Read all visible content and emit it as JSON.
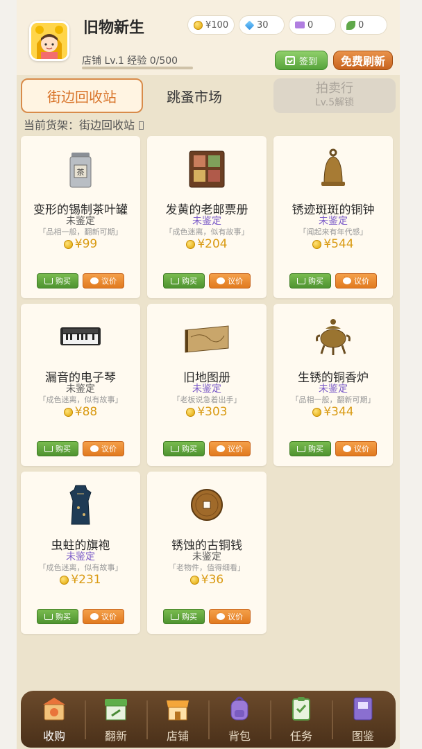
{
  "header": {
    "shop_name": "旧物新生",
    "level_text": "店铺 Lv.1  经验 0/500",
    "exp_fraction": 0.0,
    "currencies": [
      {
        "icon": "coin-icon",
        "value": "¥100"
      },
      {
        "icon": "diamond-icon",
        "value": "30"
      },
      {
        "icon": "ticket-icon",
        "value": "0"
      },
      {
        "icon": "leaf-icon",
        "value": "0"
      }
    ],
    "signin_label": "签到",
    "refresh_label": "免费刷新"
  },
  "tabs": {
    "street": "街边回收站",
    "market": "跳蚤市场",
    "auction": "拍卖行",
    "auction_unlock": "Lv.5解锁"
  },
  "shelf_label": "当前货架：街边回收站",
  "buttons": {
    "buy": "购买",
    "haggle": "议价"
  },
  "items": [
    {
      "name": "变形的锡制茶叶罐",
      "status": "未鉴定",
      "quote": "「品相一般，翻新可期」",
      "price": "¥99",
      "icon": "tea-tin-icon"
    },
    {
      "name": "发黄的老邮票册",
      "status": "未鉴定",
      "quote": "「成色迷离，似有故事」",
      "price": "¥204",
      "icon": "stamp-album-icon"
    },
    {
      "name": "锈迹斑斑的铜钟",
      "status": "未鉴定",
      "quote": "「闻起来有年代感」",
      "price": "¥544",
      "icon": "bronze-bell-icon"
    },
    {
      "name": "漏音的电子琴",
      "status": "未鉴定",
      "quote": "「成色迷离，似有故事」",
      "price": "¥88",
      "icon": "keyboard-icon"
    },
    {
      "name": "旧地图册",
      "status": "未鉴定",
      "quote": "「老板说急着出手」",
      "price": "¥303",
      "icon": "map-book-icon"
    },
    {
      "name": "生锈的铜香炉",
      "status": "未鉴定",
      "quote": "「品相一般，翻新可期」",
      "price": "¥344",
      "icon": "incense-burner-icon"
    },
    {
      "name": "虫蛀的旗袍",
      "status": "未鉴定",
      "quote": "「成色迷离，似有故事」",
      "price": "¥231",
      "icon": "qipao-icon"
    },
    {
      "name": "锈蚀的古铜钱",
      "status": "未鉴定",
      "quote": "「老物件，值得细看」",
      "price": "¥36",
      "icon": "copper-coin-icon"
    }
  ],
  "nav": [
    {
      "label": "收购",
      "icon": "shop-box-icon",
      "active": true
    },
    {
      "label": "翻新",
      "icon": "workshop-icon"
    },
    {
      "label": "店铺",
      "icon": "storefront-icon"
    },
    {
      "label": "背包",
      "icon": "backpack-icon"
    },
    {
      "label": "任务",
      "icon": "clipboard-icon"
    },
    {
      "label": "图鉴",
      "icon": "book-icon"
    }
  ],
  "colors": {
    "accent_orange": "#d8742a",
    "status_purple": "#7a5ac8",
    "price_gold": "#d99a12",
    "buy_green": "#4e9330",
    "haggle_orange": "#e17a1f",
    "nav_brown": "#5a3c22"
  }
}
